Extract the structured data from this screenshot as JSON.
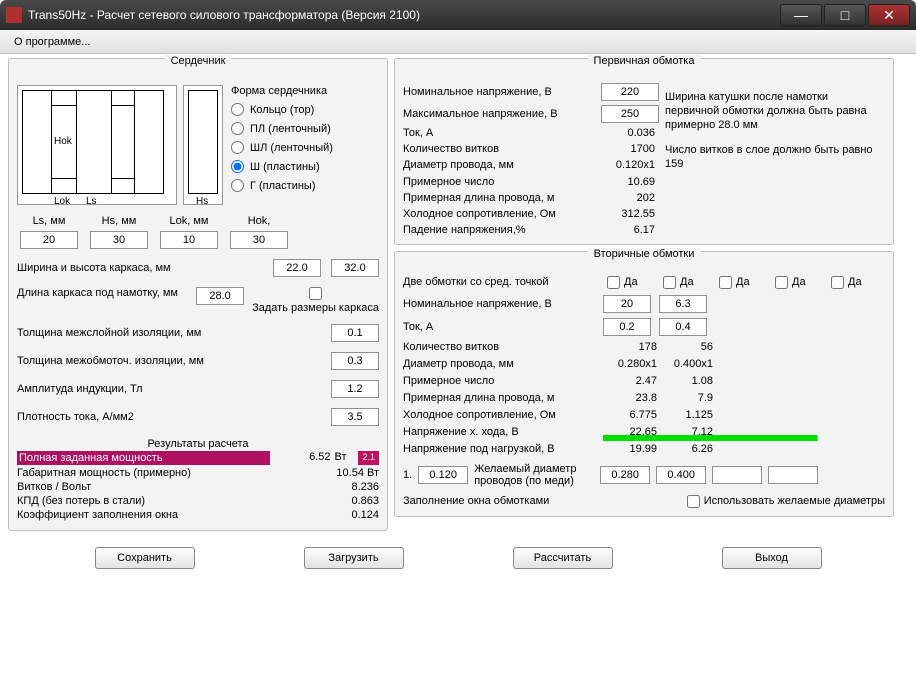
{
  "window": {
    "title": "Trans50Hz - Расчет сетевого силового трансформатора (Версия 2100)"
  },
  "menu": {
    "about": "О программе..."
  },
  "titles": {
    "core": "Сердечник",
    "primary": "Первичная обмотка",
    "secondary": "Вторичные обмотки",
    "results": "Результаты расчета"
  },
  "core": {
    "form_label": "Форма сердечника",
    "shapes": {
      "ring": "Кольцо (тор)",
      "pl": "ПЛ (ленточный)",
      "shl": "ШЛ (ленточный)",
      "sh": "Ш (пластины)",
      "g": "Г (пластины)"
    },
    "dims": {
      "ls_label": "Ls, мм",
      "hs_label": "Hs, мм",
      "lok_label": "Lok, мм",
      "hok_label": "Hok,",
      "ls": "20",
      "hs": "30",
      "lok": "10",
      "hok": "30"
    },
    "carcass_wh_label": "Ширина и высота каркаса, мм",
    "carcass_w": "22.0",
    "carcass_h": "32.0",
    "carcass_len_label": "Длина каркаса под намотку, мм",
    "carcass_len": "28.0",
    "set_sizes_checkbox": "Задать размеры каркаса",
    "interlayer_label": "Толщина межслойной изоляции, мм",
    "interlayer": "0.1",
    "interwind_label": "Толщина межобмоточ. изоляции, мм",
    "interwind": "0.3",
    "induction_label": "Амплитуда индукции, Тл",
    "induction": "1.2",
    "currdens_label": "Плотность тока, А/мм2",
    "currdens": "3.5",
    "diagram_labels": {
      "hok": "Hok",
      "lok": "Lok",
      "ls": "Ls",
      "hs": "Hs"
    }
  },
  "results": {
    "power_set_label": "Полная заданная мощность",
    "power_set": "6.52",
    "unit_w": "Вт",
    "tag": "2.1",
    "overall_power_label": "Габаритная мощность (примерно)",
    "overall_power": "10.54 Вт",
    "turns_volt_label": "Витков / Вольт",
    "turns_volt": "8.236",
    "eff_label": "КПД (без потерь в стали)",
    "eff": "0.863",
    "fill_label": "Коэффициент заполнения окна",
    "fill": "0.124"
  },
  "primary": {
    "rows": {
      "nominal_v": {
        "label": "Номинальное напряжение, В",
        "value": "220"
      },
      "max_v": {
        "label": "Максимальное напряжение, В",
        "value": "250"
      },
      "current": {
        "label": "Ток, А",
        "value": "0.036"
      },
      "turns": {
        "label": "Количество витков",
        "value": "1700"
      },
      "wire_d": {
        "label": "Диаметр провода, мм",
        "value": "0.120x1"
      },
      "approx_num": {
        "label": "Примерное число",
        "value": "10.69"
      },
      "wire_len": {
        "label": "Примерная длина провода, м",
        "value": "202"
      },
      "cold_r": {
        "label": "Холодное сопротивление, Ом",
        "value": "312.55"
      },
      "vdrop": {
        "label": "Падение напряжения,%",
        "value": "6.17"
      }
    },
    "note1": "Ширина катушки после намотки первичной обмотки должна быть равна примерно 28.0 мм",
    "note2": "Число витков в слое должно быть равно 159"
  },
  "secondary": {
    "ct_label": "Две обмотки со сред. точкой",
    "yes": "Да",
    "rows": {
      "nominal_v": {
        "label": "Номинальное напряжение, В",
        "c1": "20",
        "c2": "6.3"
      },
      "current": {
        "label": "Ток, А",
        "c1": "0.2",
        "c2": "0.4"
      },
      "turns": {
        "label": "Количество витков",
        "c1": "178",
        "c2": "56"
      },
      "wire_d": {
        "label": "Диаметр провода, мм",
        "c1": "0.280x1",
        "c2": "0.400x1"
      },
      "approx_num": {
        "label": "Примерное число",
        "c1": "2.47",
        "c2": "1.08"
      },
      "wire_len": {
        "label": "Примерная длина провода, м",
        "c1": "23.8",
        "c2": "7.9"
      },
      "cold_r": {
        "label": "Холодное сопротивление, Ом",
        "c1": "6.775",
        "c2": "1.125"
      },
      "voc": {
        "label": "Напряжение х. хода, В",
        "c1": "22.65",
        "c2": "7.12"
      },
      "vload": {
        "label": "Напряжение под нагрузкой, В",
        "c1": "19.99",
        "c2": "6.26"
      }
    },
    "wire": {
      "num": "1.",
      "base": "0.120",
      "desired_label": "Желаемый диаметр проводов (по меди)",
      "c1": "0.280",
      "c2": "0.400"
    },
    "fill_label": "Заполнение окна обмотками",
    "use_desired": "Использовать желаемые диаметры"
  },
  "buttons": {
    "save": "Сохранить",
    "load": "Загрузить",
    "calc": "Рассчитать",
    "exit": "Выход"
  }
}
